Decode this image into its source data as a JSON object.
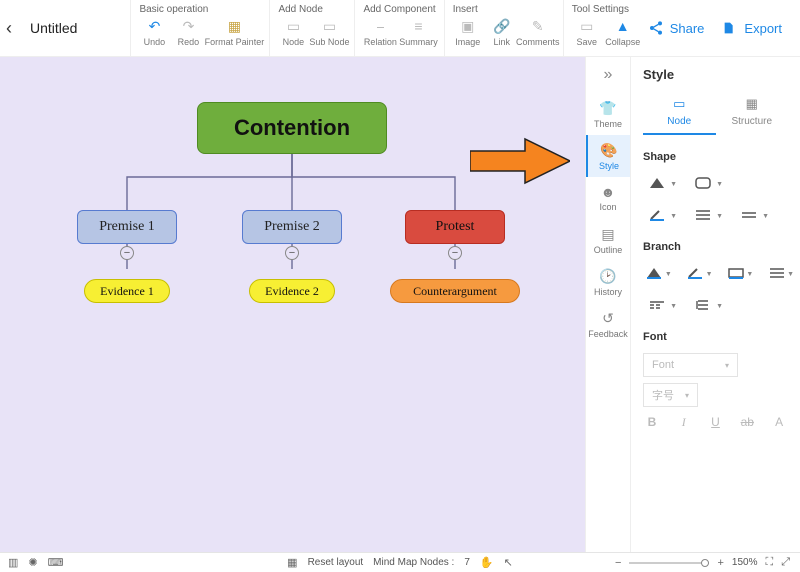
{
  "header": {
    "doc_title": "Untitled",
    "groups": {
      "basic": {
        "label": "Basic operation",
        "undo": "Undo",
        "redo": "Redo",
        "format_painter": "Format Painter"
      },
      "add_node": {
        "label": "Add Node",
        "node": "Node",
        "sub_node": "Sub Node"
      },
      "add_component": {
        "label": "Add Component",
        "relation": "Relation",
        "summary": "Summary"
      },
      "insert": {
        "label": "Insert",
        "image": "Image",
        "link": "Link",
        "comments": "Comments"
      },
      "tool_settings": {
        "label": "Tool Settings",
        "save": "Save",
        "collapse": "Collapse"
      }
    },
    "share": "Share",
    "export": "Export"
  },
  "mindmap": {
    "root": "Contention",
    "premise1": "Premise 1",
    "premise2": "Premise 2",
    "protest": "Protest",
    "evidence1": "Evidence 1",
    "evidence2": "Evidence 2",
    "counterargument": "Counterargument"
  },
  "rail": {
    "theme": "Theme",
    "style": "Style",
    "icon": "Icon",
    "outline": "Outline",
    "history": "History",
    "feedback": "Feedback"
  },
  "panel": {
    "title": "Style",
    "tab_node": "Node",
    "tab_structure": "Structure",
    "sec_shape": "Shape",
    "sec_branch": "Branch",
    "sec_font": "Font",
    "font_placeholder": "Font",
    "lang_placeholder": "字号"
  },
  "footer": {
    "reset_layout": "Reset layout",
    "nodes_label": "Mind Map Nodes :",
    "nodes_count": "7",
    "zoom": "150%"
  }
}
